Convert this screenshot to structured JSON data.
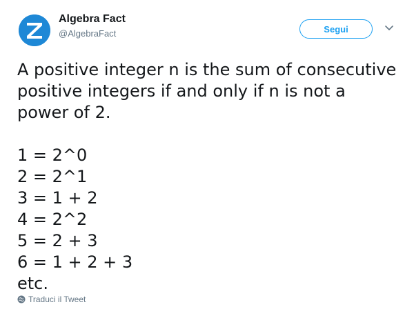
{
  "header": {
    "avatar_icon": "algebra-fact-logo-icon",
    "display_name": "Algebra Fact",
    "handle": "@AlgebraFact",
    "follow_label": "Segui",
    "menu_icon": "chevron-down-icon"
  },
  "tweet": {
    "lines": [
      "A positive integer n is the sum of consecutive",
      "positive integers if and only if n is not a",
      "power of 2.",
      "",
      "1 = 2^0",
      "2 = 2^1",
      "3 = 1 + 2",
      "4 = 2^2",
      "5 = 2 + 3",
      "6 = 1 + 2 + 3",
      "etc."
    ]
  },
  "footer": {
    "translate_icon": "globe-icon",
    "translate_label": "Traduci il Tweet"
  },
  "colors": {
    "accent": "#1da1f2",
    "avatar_bg": "#1e88d6",
    "text_primary": "#14171a",
    "text_secondary": "#657786"
  }
}
